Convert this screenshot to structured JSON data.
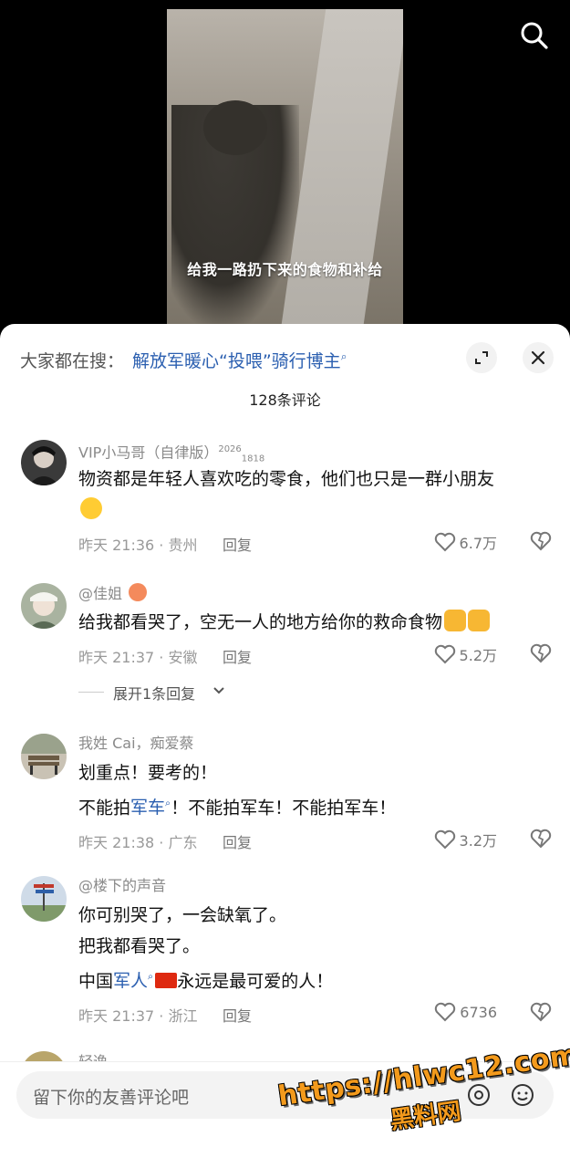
{
  "video": {
    "caption": "给我一路扔下来的食物和补给"
  },
  "header": {
    "hot_prefix": "大家都在搜：",
    "hot_search": "解放军暖心“投喂”骑行博主",
    "comment_count": "128条评论"
  },
  "comments": [
    {
      "username": "VIP小马哥（自律版）",
      "sup": "2026",
      "sub": "1818",
      "lines": [
        "物资都是年轻人喜欢吃的零食，他们也只是一群小朋友"
      ],
      "time_loc": "昨天 21:36 · 贵州",
      "reply": "回复",
      "likes": "6.7万"
    },
    {
      "username": "@佳姐",
      "lines": [
        "给我都看哭了，空无一人的地方给你的救命食物"
      ],
      "time_loc": "昨天 21:37 · 安徽",
      "reply": "回复",
      "likes": "5.2万",
      "expand": "展开1条回复"
    },
    {
      "username": "我姓 Cai，痴爱蔡",
      "lines": [
        "划重点！要考的！"
      ],
      "line2_prefix": "不能拍",
      "line2_kw": "军车",
      "line2_suffix": "！不能拍军车！不能拍军车！",
      "time_loc": "昨天 21:38 · 广东",
      "reply": "回复",
      "likes": "3.2万"
    },
    {
      "username": "@楼下的声音",
      "lines": [
        "你可别哭了，一会缺氧了。",
        "把我都看哭了。"
      ],
      "line3_prefix": "中国",
      "line3_kw": "军人",
      "line3_suffix": "永远是最可爱的人！",
      "time_loc": "昨天 21:37 · 浙江",
      "reply": "回复",
      "likes": "6736"
    }
  ],
  "next_user": "轻逸",
  "input": {
    "placeholder": "留下你的友善评论吧"
  },
  "watermark": {
    "url": "https://hlwc12.com",
    "name": "黑料网"
  },
  "colors": {
    "link": "#2b5fb0",
    "watermark": "#f39a1c"
  }
}
